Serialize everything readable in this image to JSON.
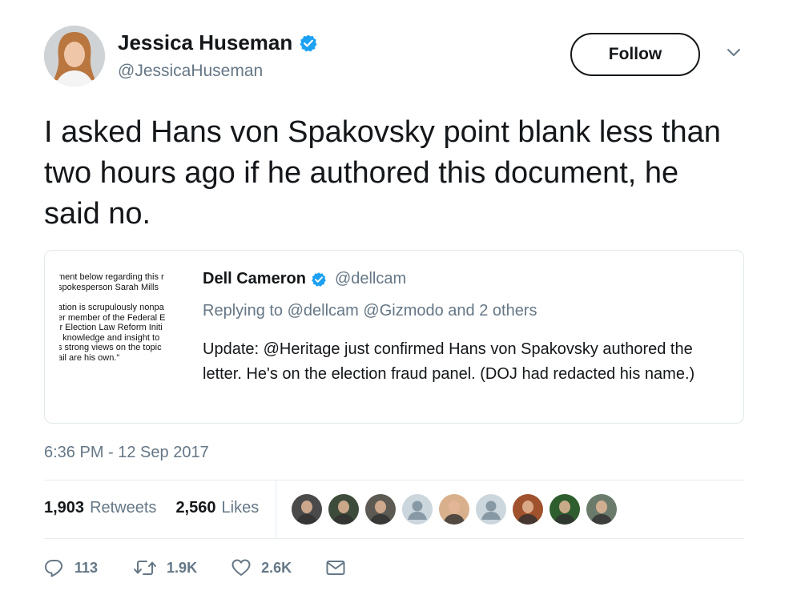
{
  "author": {
    "name": "Jessica Huseman",
    "handle": "@JessicaHuseman",
    "verified": true
  },
  "follow_label": "Follow",
  "tweet_text": "I asked Hans von Spakovsky point blank less than two hours ago if he authored this document, he said no.",
  "quoted_tweet": {
    "name": "Dell Cameron",
    "handle": "@dellcam",
    "verified": true,
    "reply_context": "Replying to @dellcam @Gizmodo and 2 others",
    "text": "Update: @Heritage just confirmed Hans von Spakovsky authored the letter. He's on the election fraud panel. (DOJ had redacted his name.)",
    "image_text_lines": [
      "ment below regarding this r",
      "spokesperson Sarah Mills",
      "ation is scrupulously nonpa",
      "er member of the Federal E",
      "ir Election Law Reform Initi",
      "! knowledge and insight to",
      "s strong views on the topic",
      "ail are his own.\""
    ]
  },
  "timestamp": "6:36 PM - 12 Sep 2017",
  "stats": {
    "retweets_count": "1,903",
    "retweets_label": "Retweets",
    "likes_count": "2,560",
    "likes_label": "Likes"
  },
  "likers": [
    {
      "icon": "avatar-photo",
      "color": "#4a4a4a"
    },
    {
      "icon": "avatar-photo",
      "color": "#3d4b3a"
    },
    {
      "icon": "avatar-photo",
      "color": "#5c5a52"
    },
    {
      "icon": "default-avatar",
      "color": "#ccd6dd"
    },
    {
      "icon": "avatar-photo",
      "color": "#d9b08c"
    },
    {
      "icon": "default-avatar",
      "color": "#ccd6dd"
    },
    {
      "icon": "avatar-photo",
      "color": "#a0522d"
    },
    {
      "icon": "avatar-photo",
      "color": "#2e5d2e"
    },
    {
      "icon": "avatar-photo",
      "color": "#6b7b6b"
    }
  ],
  "actions": {
    "reply_count": "113",
    "retweet_count": "1.9K",
    "like_count": "2.6K"
  },
  "colors": {
    "verified_blue": "#1da1f2",
    "secondary_text": "#657786",
    "primary_text": "#14171a",
    "divider": "#e6ecf0"
  }
}
